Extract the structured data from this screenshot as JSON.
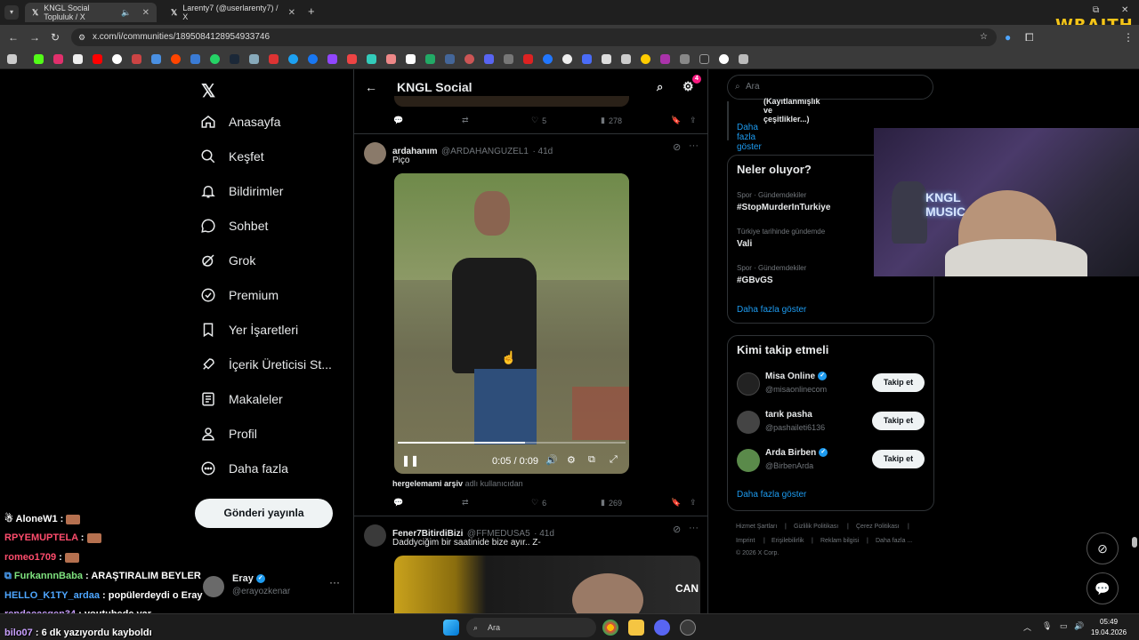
{
  "browser": {
    "tabs": [
      {
        "title": "KNGL Social Topluluk / X",
        "active": true
      },
      {
        "title": "Larenty7 (@userlarenty7) / X",
        "active": false
      }
    ],
    "url": "x.com/i/communities/1895084128954933746",
    "overlay_brand": "WRAITH"
  },
  "nav": {
    "items": [
      {
        "label": "Anasayfa",
        "icon": "home-icon"
      },
      {
        "label": "Keşfet",
        "icon": "search-icon"
      },
      {
        "label": "Bildirimler",
        "icon": "bell-icon"
      },
      {
        "label": "Sohbet",
        "icon": "chat-icon"
      },
      {
        "label": "Grok",
        "icon": "grok-icon"
      },
      {
        "label": "Premium",
        "icon": "premium-icon"
      },
      {
        "label": "Yer İşaretleri",
        "icon": "bookmark-icon"
      },
      {
        "label": "İçerik Üreticisi St...",
        "icon": "rocket-icon"
      },
      {
        "label": "Makaleler",
        "icon": "article-icon"
      },
      {
        "label": "Profil",
        "icon": "user-icon"
      },
      {
        "label": "Daha fazla",
        "icon": "more-icon"
      }
    ],
    "post_button": "Gönderi yayınla",
    "profile": {
      "name": "Eray",
      "handle": "@erayozkenar"
    }
  },
  "center": {
    "title": "KNGL Social",
    "settings_badge": "4",
    "first_tweet_actions": {
      "likes": "5",
      "views": "278"
    },
    "tweet": {
      "name": "ardahanım",
      "handle": "@ARDAHANGUZEL1",
      "time": "· 41d",
      "text": "Piço",
      "video_time": "0:05 / 0:09",
      "video_progress": 0.56,
      "attribution_user": "hergelemami arşiv",
      "attribution_suffix": "adlı kullanıcıdan",
      "likes": "6",
      "views": "269"
    },
    "tweet2": {
      "name": "Fener7BitirdiBizi",
      "handle": "@FFMEDUSA5",
      "time": "· 41d",
      "text": "Daddyciğim bir saatinide bize ayır.. Z-",
      "media_label": "CAN"
    }
  },
  "right": {
    "search_placeholder": "Ara",
    "top_partial_text": "(Kayıtlanmışlık ve çeşitlikler...)",
    "top_show_more": "Daha fazla göster",
    "trends": {
      "title": "Neler oluyor?",
      "items": [
        {
          "category": "Spor · Gündemdekiler",
          "tag": "#StopMurderInTurkiye"
        },
        {
          "category": "Türkiye tarihinde gündemde",
          "tag": "Vali"
        },
        {
          "category": "Spor · Gündemdekiler",
          "tag": "#GBvGS"
        }
      ],
      "show_more": "Daha fazla göster"
    },
    "who_to_follow": {
      "title": "Kimi takip etmeli",
      "items": [
        {
          "name": "Misa Online",
          "handle": "@misaonlinecom",
          "verified": true,
          "button": "Takip et"
        },
        {
          "name": "tarık pasha",
          "handle": "@pashaileti6136",
          "verified": false,
          "button": "Takip et"
        },
        {
          "name": "Arda Birben",
          "handle": "@BirbenArda",
          "verified": true,
          "button": "Takip et"
        }
      ],
      "show_more": "Daha fazla göster"
    },
    "footer": {
      "links": [
        "Hizmet Şartları",
        "|",
        "Gizlilik Politikası",
        "|",
        "Çerez Politikası",
        "|",
        "Imprint",
        "|",
        "Erişilebilirlik",
        "|",
        "Reklam bilgisi",
        "|",
        "Daha fazla ..."
      ],
      "copyright": "© 2026 X Corp."
    }
  },
  "webcam": {
    "sign_line1": "KNGL",
    "sign_line2": "MUSIC"
  },
  "chat": [
    {
      "user": "AloneW1",
      "user_color": "#ffffff",
      "message": "",
      "emote": true
    },
    {
      "user": "RPYEMUPTELA",
      "user_color": "#ff4d6d",
      "message": "",
      "emote": true
    },
    {
      "user": "romeo1709",
      "user_color": "#ff4d6d",
      "message": "",
      "emote": true
    },
    {
      "user": "FurkannnBaba",
      "user_color": "#7fe37f",
      "message": "ARAŞTIRALIM BEYLER",
      "emote": false
    },
    {
      "user": "HELLO_K1TY_ardaa",
      "user_color": "#4ea6ff",
      "message": "popülerdeydi o Eray",
      "emote": false
    },
    {
      "user": "rendacasqen34",
      "user_color": "#c9a0ff",
      "message": "youtubede var",
      "emote": false
    },
    {
      "user": "bilo07",
      "user_color": "#c9a0ff",
      "message": "6 dk yazıyordu kayboldı",
      "emote": false
    }
  ],
  "taskbar": {
    "search_placeholder": "Ara",
    "time": "05:49",
    "date": "19.04.2026"
  }
}
